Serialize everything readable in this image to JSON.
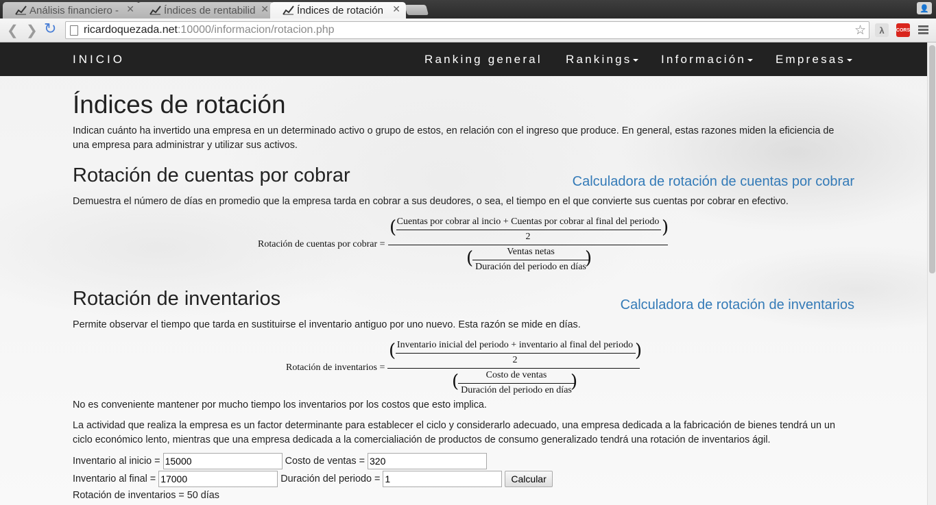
{
  "browser": {
    "tabs": [
      {
        "title": "Análisis financiero -"
      },
      {
        "title": "Índices de rentabilid"
      },
      {
        "title": "Índices de rotación"
      }
    ],
    "url": {
      "host": "ricardoquezada.net",
      "path": ":10000/informacion/rotacion.php"
    },
    "extensions": {
      "lambda": "λ",
      "cors": "CORS"
    }
  },
  "navbar": {
    "brand": "INICIO",
    "items": [
      "Ranking general",
      "Rankings",
      "Información",
      "Empresas"
    ]
  },
  "page": {
    "title": "Índices de rotación",
    "intro": "Indican cuánto ha invertido una empresa en un determinado activo o grupo de estos, en relación con el ingreso que produce. En general, estas razones miden la eficiencia de una empresa para administrar y utilizar sus activos.",
    "section1": {
      "heading": "Rotación de cuentas por cobrar",
      "link": "Calculadora de rotación de cuentas por cobrar",
      "description": "Demuestra el número de días en promedio que la empresa tarda en cobrar a sus deudores, o sea, el tiempo en el que convierte sus cuentas por cobrar en efectivo.",
      "formula": {
        "lhs": "Rotación de cuentas por cobrar =",
        "num_top": "Cuentas por cobrar al incio + Cuentas por cobrar al final del periodo",
        "num_bottom": "2",
        "den_top": "Ventas netas",
        "den_bottom": "Duración del periodo en días"
      }
    },
    "section2": {
      "heading": "Rotación de inventarios",
      "link": "Calculadora de rotación de inventarios",
      "description": "Permite observar el tiempo que tarda en sustituirse el inventario antiguo por uno nuevo. Esta razón se mide en días.",
      "formula": {
        "lhs": "Rotación de inventarios =",
        "num_top": "Inventario inicial del periodo + inventario al final del periodo",
        "num_bottom": "2",
        "den_top": "Costo de ventas",
        "den_bottom": "Duración del periodo en días"
      },
      "note1": "No es conveniente mantener por mucho tiempo los inventarios por los costos que esto implica.",
      "note2": "La actividad que realiza la empresa es un factor determinante para establecer el ciclo y considerarlo adecuado, una empresa dedicada a la fabricación de bienes tendrá un un ciclo económico lento, mientras que una empresa dedicada a la comercialiación de productos de consumo generalizado tendrá una rotación de inventarios ágil."
    },
    "calculator": {
      "inv_inicio_label": "Inventario al inicio =",
      "inv_inicio_value": "15000",
      "costo_label": "Costo de ventas =",
      "costo_value": "320",
      "inv_final_label": "Inventario al final =",
      "inv_final_value": "17000",
      "duracion_label": "Duración del periodo =",
      "duracion_value": "1",
      "button": "Calcular",
      "result": "Rotación de inventarios = 50 días"
    }
  }
}
